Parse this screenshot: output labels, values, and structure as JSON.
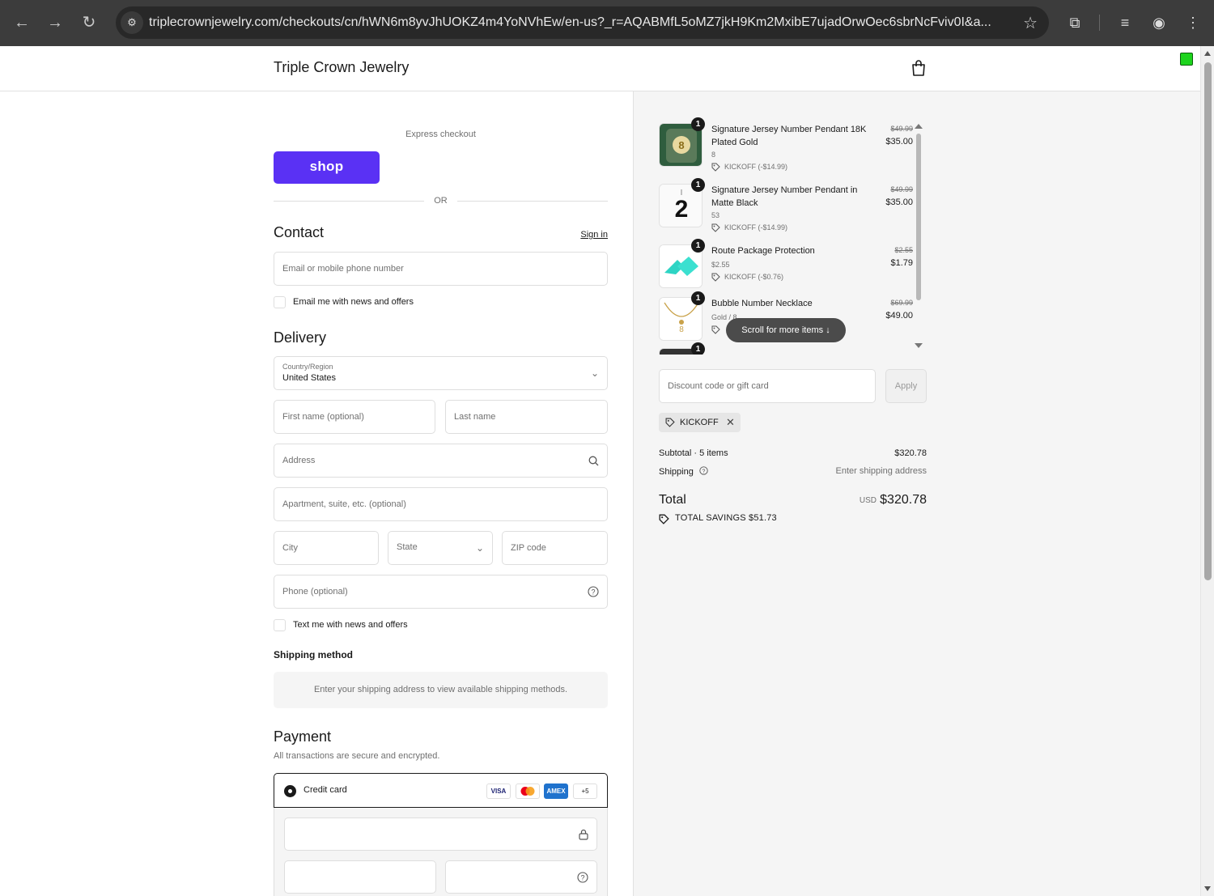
{
  "browser": {
    "url": "triplecrownjewelry.com/checkouts/cn/hWN6m8yvJhUOKZ4m4YoNVhEw/en-us?_r=AQABMfL5oMZ7jkH9Km2MxibE7ujadOrwOec6sbrNcFviv0I&a..."
  },
  "header": {
    "store_name": "Triple Crown Jewelry"
  },
  "express": {
    "label": "Express checkout",
    "shop_button": "shop",
    "or_label": "OR"
  },
  "contact": {
    "title": "Contact",
    "sign_in": "Sign in",
    "email_placeholder": "Email or mobile phone number",
    "news_checkbox": "Email me with news and offers"
  },
  "delivery": {
    "title": "Delivery",
    "country_label": "Country/Region",
    "country_value": "United States",
    "first_name": "First name (optional)",
    "last_name": "Last name",
    "address": "Address",
    "apartment": "Apartment, suite, etc. (optional)",
    "city": "City",
    "state": "State",
    "zip": "ZIP code",
    "phone": "Phone (optional)",
    "text_checkbox": "Text me with news and offers"
  },
  "shipping": {
    "title": "Shipping method",
    "message": "Enter your shipping address to view available shipping methods."
  },
  "payment": {
    "title": "Payment",
    "subtitle": "All transactions are secure and encrypted.",
    "method": "Credit card",
    "cards": [
      "VISA",
      "MC",
      "AMEX"
    ],
    "more_cards": "+5"
  },
  "cart": {
    "items": [
      {
        "qty": "1",
        "name": "Signature Jersey Number Pendant 18K Plated Gold",
        "variant": "8",
        "discount": "KICKOFF (-$14.99)",
        "original": "$49.99",
        "price": "$35.00"
      },
      {
        "qty": "1",
        "name": "Signature Jersey Number Pendant in Matte Black",
        "variant": "53",
        "discount": "KICKOFF (-$14.99)",
        "original": "$49.99",
        "price": "$35.00"
      },
      {
        "qty": "1",
        "name": "Route Package Protection",
        "variant": "$2.55",
        "discount": "KICKOFF (-$0.76)",
        "original": "$2.55",
        "price": "$1.79"
      },
      {
        "qty": "1",
        "name": "Bubble Number Necklace",
        "variant": "Gold / 8",
        "discount": "",
        "original": "$69.99",
        "price": "$49.00"
      }
    ],
    "scroll_hint": "Scroll for more items",
    "discount_placeholder": "Discount code or gift card",
    "apply": "Apply",
    "applied_code": "KICKOFF",
    "subtotal_label": "Subtotal · 5 items",
    "subtotal_value": "$320.78",
    "shipping_label": "Shipping",
    "shipping_value": "Enter shipping address",
    "total_label": "Total",
    "currency": "USD",
    "total_value": "$320.78",
    "savings": "TOTAL SAVINGS  $51.73"
  },
  "colors": {
    "shop_purple": "#5a31f4",
    "chrome_dark": "#3c3c3c",
    "panel_bg": "#f5f5f5"
  }
}
